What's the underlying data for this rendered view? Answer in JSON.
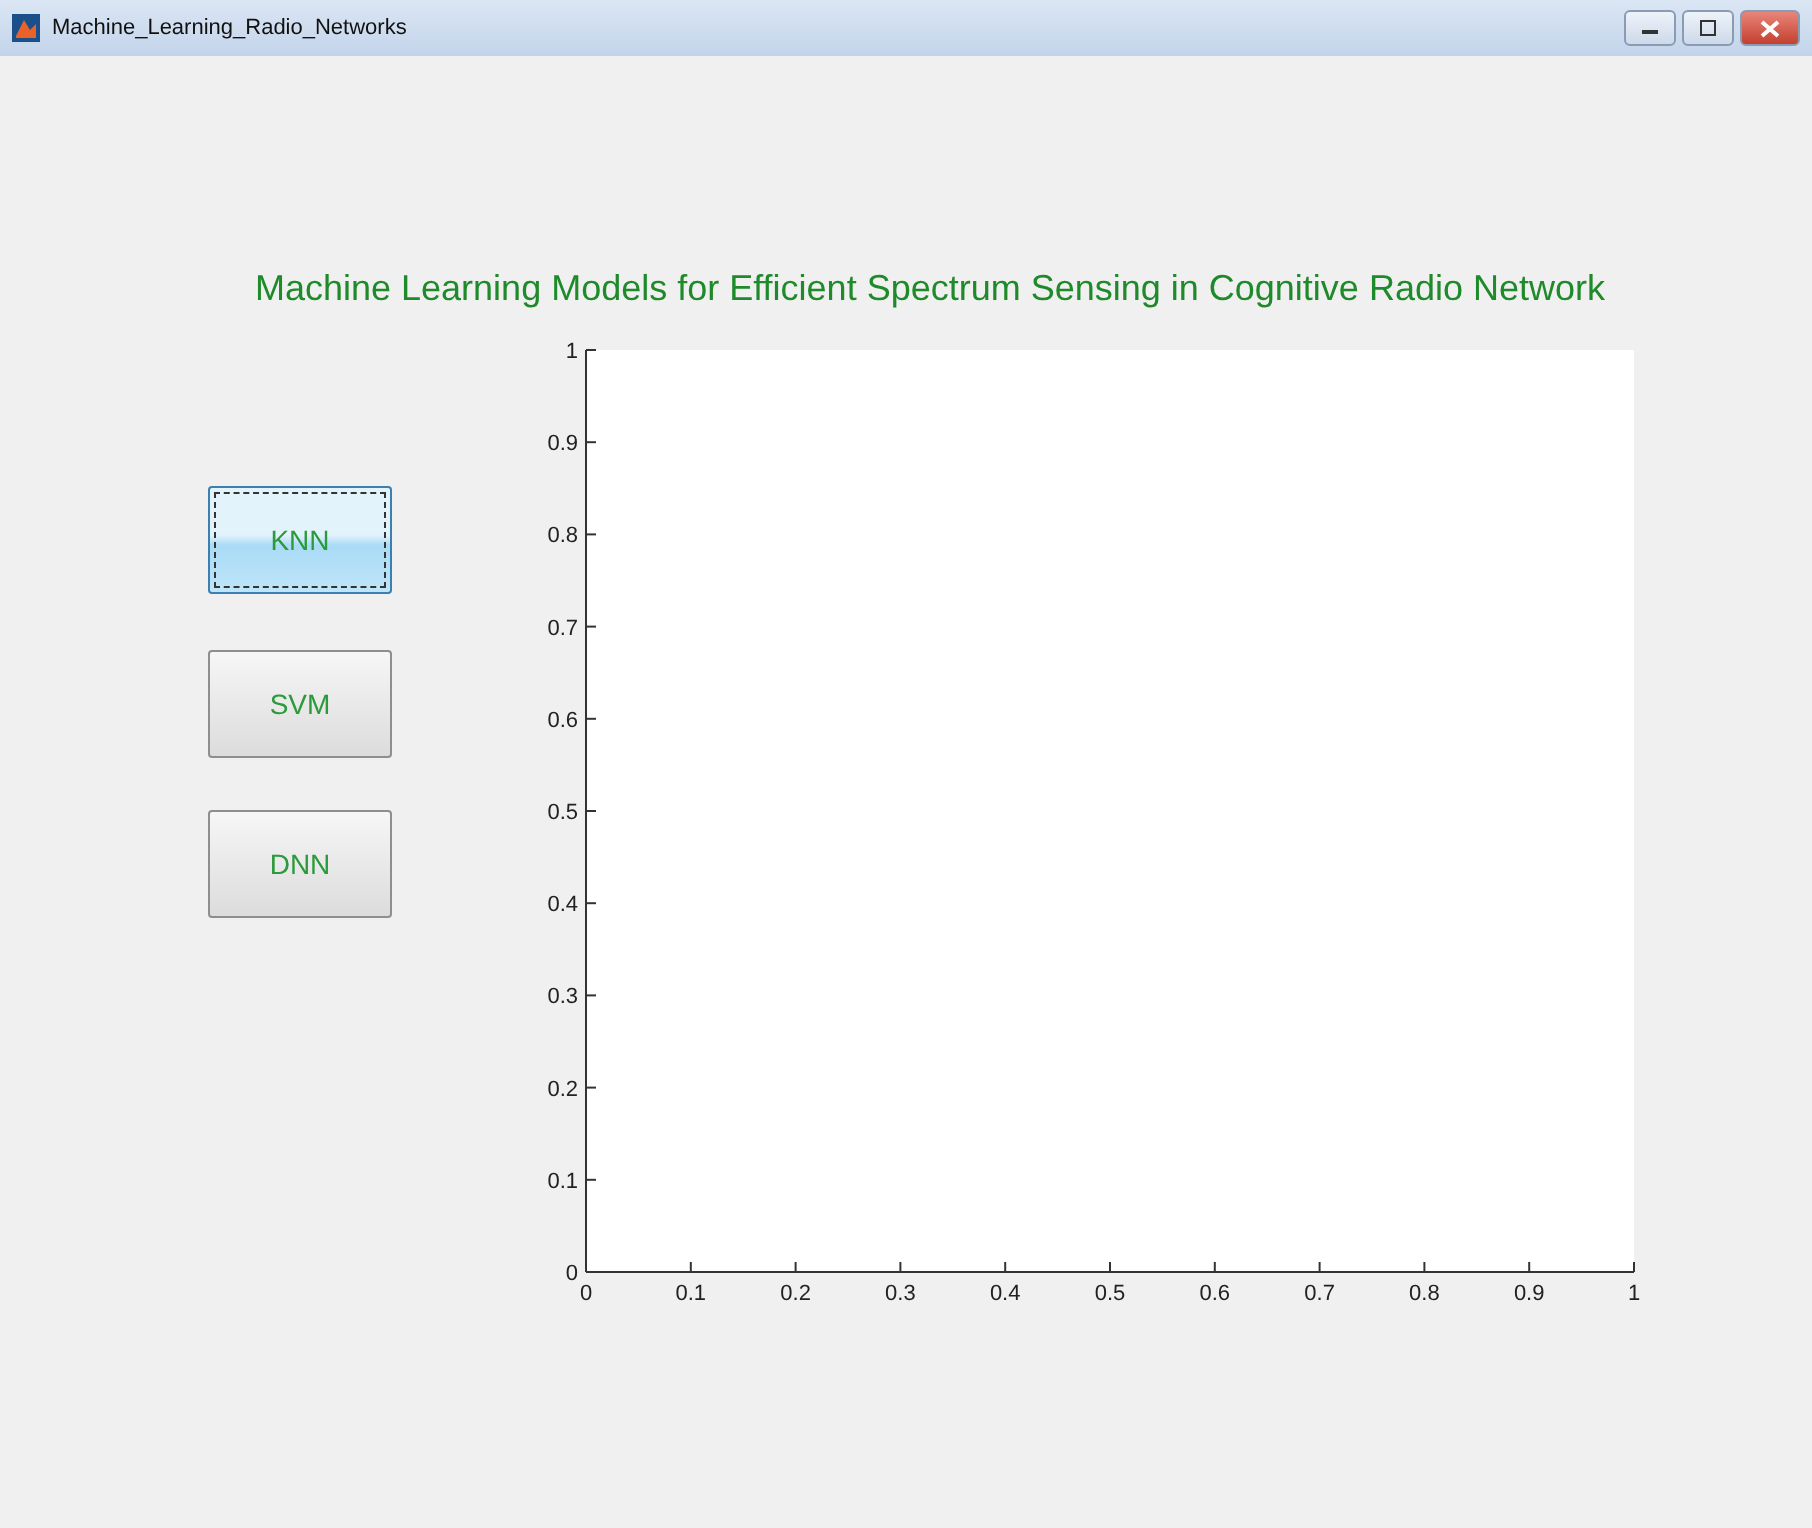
{
  "window": {
    "title": "Machine_Learning_Radio_Networks"
  },
  "heading": "Machine Learning Models  for Efficient Spectrum Sensing in Cognitive Radio Network",
  "buttons": [
    {
      "label": "KNN",
      "selected": true
    },
    {
      "label": "SVM",
      "selected": false
    },
    {
      "label": "DNN",
      "selected": false
    }
  ],
  "axes": {
    "chart_data": {
      "type": "line",
      "xlim": [
        0,
        1
      ],
      "ylim": [
        0,
        1
      ],
      "xticks": [
        0,
        0.1,
        0.2,
        0.3,
        0.4,
        0.5,
        0.6,
        0.7,
        0.8,
        0.9,
        1
      ],
      "yticks": [
        0,
        0.1,
        0.2,
        0.3,
        0.4,
        0.5,
        0.6,
        0.7,
        0.8,
        0.9,
        1
      ]
    }
  }
}
